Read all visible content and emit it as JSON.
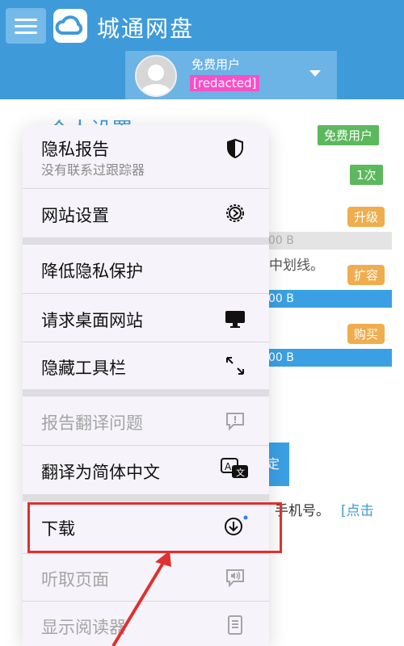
{
  "header": {
    "app_title": "城通网盘",
    "user_role": "免费用户",
    "user_name": "[redacted]"
  },
  "page": {
    "heading": "个人设置",
    "badges": {
      "free": "免费用户",
      "count": "1次",
      "upgrade": "升级",
      "expand": "扩容",
      "buy": "购买"
    },
    "bars": [
      "00 B",
      "00 B",
      "00 B"
    ],
    "text_1": "中划线。",
    "button_partial": "定",
    "text_2": "手机号。",
    "link": "[点击"
  },
  "menu": {
    "items": [
      {
        "label": "隐私报告",
        "sub": "没有联系过跟踪器",
        "icon": "shield-icon"
      },
      {
        "label": "网站设置",
        "icon": "gear-icon"
      },
      {
        "label": "降低隐私保护",
        "icon": ""
      },
      {
        "label": "请求桌面网站",
        "icon": "desktop-icon"
      },
      {
        "label": "隐藏工具栏",
        "icon": "expand-arrows-icon"
      },
      {
        "label": "报告翻译问题",
        "icon": "report-bubble-icon"
      },
      {
        "label": "翻译为简体中文",
        "icon": "translate-icon"
      },
      {
        "label": "下载",
        "icon": "download-icon"
      },
      {
        "label": "听取页面",
        "icon": "speaker-bubble-icon"
      },
      {
        "label": "显示阅读器",
        "icon": "reader-icon"
      }
    ]
  },
  "colors": {
    "header_bg": "#3f9ad9",
    "highlight": "#e0302f",
    "badge_green": "#5cb85c",
    "badge_orange": "#f0ad4e"
  }
}
